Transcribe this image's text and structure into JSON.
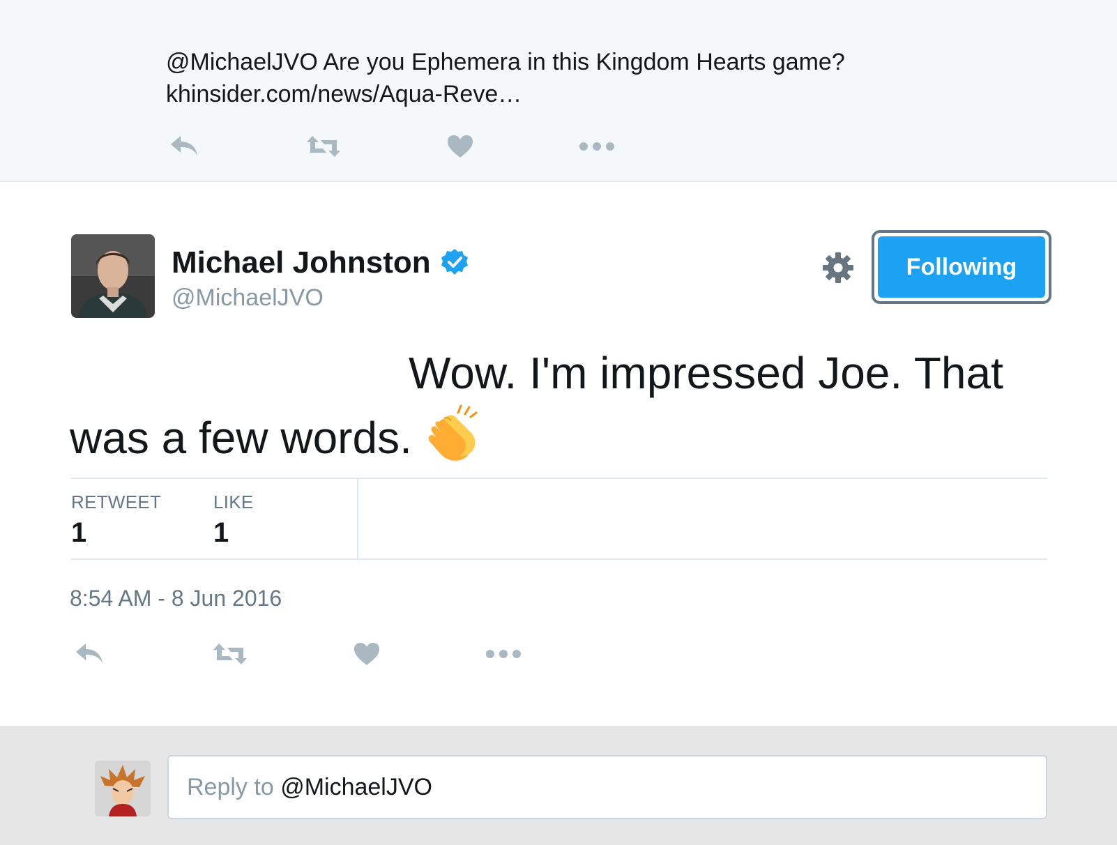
{
  "parent_tweet": {
    "text_line1": "@MichaelJVO Are you Ephemera in this Kingdom Hearts game?",
    "text_line2": "khinsider.com/news/Aqua-Reve…"
  },
  "tweet": {
    "display_name": "Michael Johnston",
    "handle": "@MichaelJVO",
    "verified": true,
    "follow_button_label": "Following",
    "text_line1": "Wow. I'm impressed Joe. That",
    "text_line2": "was a few words.",
    "emoji": "clapping-hands",
    "stats": {
      "retweet_label": "RETWEET",
      "retweet_count": "1",
      "like_label": "LIKE",
      "like_count": "1"
    },
    "timestamp": "8:54 AM - 8 Jun 2016"
  },
  "reply": {
    "placeholder_prefix": "Reply to ",
    "mention": "@MichaelJVO"
  },
  "colors": {
    "accent": "#1da1f2",
    "icon_gray": "#aab8c2",
    "text_dark": "#14171a",
    "text_muted": "#657786"
  },
  "icons": [
    "reply-icon",
    "retweet-icon",
    "heart-icon",
    "more-icon",
    "gear-icon",
    "verified-badge-icon",
    "clapping-hands-icon"
  ]
}
